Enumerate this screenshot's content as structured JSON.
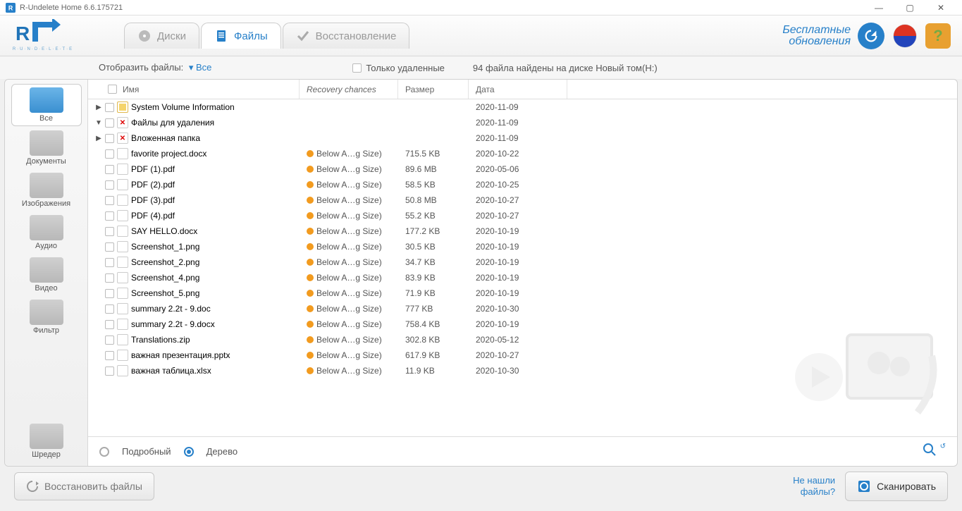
{
  "window": {
    "title": "R-Undelete Home 6.6.175721"
  },
  "header": {
    "tabs": [
      {
        "label": "Диски"
      },
      {
        "label": "Файлы"
      },
      {
        "label": "Восстановление"
      }
    ],
    "updates": {
      "line1": "Бесплатные",
      "line2": "обновления"
    }
  },
  "toolbar": {
    "show_files": "Отобразить файлы:",
    "show_files_value": "Все",
    "deleted_only": "Только удаленные",
    "count_text": "94 файла найдены на диске Новый том(H:)"
  },
  "sidebar": {
    "items": [
      {
        "label": "Все"
      },
      {
        "label": "Документы"
      },
      {
        "label": "Изображения"
      },
      {
        "label": "Аудио"
      },
      {
        "label": "Видео"
      },
      {
        "label": "Фильтр"
      }
    ],
    "shredder": "Шредер"
  },
  "columns": {
    "name": "Имя",
    "chance": "Recovery chances",
    "size": "Размер",
    "date": "Дата"
  },
  "rows": [
    {
      "indent": 1,
      "expand": "▶",
      "icon": "folder",
      "name": "System Volume Information",
      "chance": "",
      "size": "",
      "date": "2020-11-09"
    },
    {
      "indent": 1,
      "expand": "▼",
      "icon": "deleted",
      "name": "Файлы для удаления",
      "chance": "",
      "size": "",
      "date": "2020-11-09"
    },
    {
      "indent": 2,
      "expand": "▶",
      "icon": "deleted",
      "name": "Вложенная папка",
      "chance": "",
      "size": "",
      "date": "2020-11-09"
    },
    {
      "indent": 2,
      "expand": "",
      "icon": "file",
      "name": "favorite project.docx",
      "chance": "Below A…g Size)",
      "size": "715.5 KB",
      "date": "2020-10-22"
    },
    {
      "indent": 2,
      "expand": "",
      "icon": "file",
      "name": "PDF (1).pdf",
      "chance": "Below A…g Size)",
      "size": "89.6 MB",
      "date": "2020-05-06"
    },
    {
      "indent": 2,
      "expand": "",
      "icon": "file",
      "name": "PDF (2).pdf",
      "chance": "Below A…g Size)",
      "size": "58.5 KB",
      "date": "2020-10-25"
    },
    {
      "indent": 2,
      "expand": "",
      "icon": "file",
      "name": "PDF (3).pdf",
      "chance": "Below A…g Size)",
      "size": "50.8 MB",
      "date": "2020-10-27"
    },
    {
      "indent": 2,
      "expand": "",
      "icon": "file",
      "name": "PDF (4).pdf",
      "chance": "Below A…g Size)",
      "size": "55.2 KB",
      "date": "2020-10-27"
    },
    {
      "indent": 2,
      "expand": "",
      "icon": "file",
      "name": "SAY HELLO.docx",
      "chance": "Below A…g Size)",
      "size": "177.2 KB",
      "date": "2020-10-19"
    },
    {
      "indent": 2,
      "expand": "",
      "icon": "file",
      "name": "Screenshot_1.png",
      "chance": "Below A…g Size)",
      "size": "30.5 KB",
      "date": "2020-10-19"
    },
    {
      "indent": 2,
      "expand": "",
      "icon": "file",
      "name": "Screenshot_2.png",
      "chance": "Below A…g Size)",
      "size": "34.7 KB",
      "date": "2020-10-19"
    },
    {
      "indent": 2,
      "expand": "",
      "icon": "file",
      "name": "Screenshot_4.png",
      "chance": "Below A…g Size)",
      "size": "83.9 KB",
      "date": "2020-10-19"
    },
    {
      "indent": 2,
      "expand": "",
      "icon": "file",
      "name": "Screenshot_5.png",
      "chance": "Below A…g Size)",
      "size": "71.9 KB",
      "date": "2020-10-19"
    },
    {
      "indent": 2,
      "expand": "",
      "icon": "file",
      "name": "summary 2.2t - 9.doc",
      "chance": "Below A…g Size)",
      "size": "777 KB",
      "date": "2020-10-30"
    },
    {
      "indent": 2,
      "expand": "",
      "icon": "file",
      "name": "summary 2.2t - 9.docx",
      "chance": "Below A…g Size)",
      "size": "758.4 KB",
      "date": "2020-10-19"
    },
    {
      "indent": 2,
      "expand": "",
      "icon": "file",
      "name": "Translations.zip",
      "chance": "Below A…g Size)",
      "size": "302.8 KB",
      "date": "2020-05-12"
    },
    {
      "indent": 2,
      "expand": "",
      "icon": "file",
      "name": "важная презентация.pptx",
      "chance": "Below A…g Size)",
      "size": "617.9 KB",
      "date": "2020-10-27"
    },
    {
      "indent": 2,
      "expand": "",
      "icon": "file",
      "name": "важная таблица.xlsx",
      "chance": "Below A…g Size)",
      "size": "11.9 KB",
      "date": "2020-10-30"
    }
  ],
  "footer": {
    "detailed": "Подробный",
    "tree": "Дерево"
  },
  "bottom": {
    "recover": "Восстановить файлы",
    "not_found_1": "Не нашли",
    "not_found_2": "файлы?",
    "scan": "Сканировать"
  }
}
